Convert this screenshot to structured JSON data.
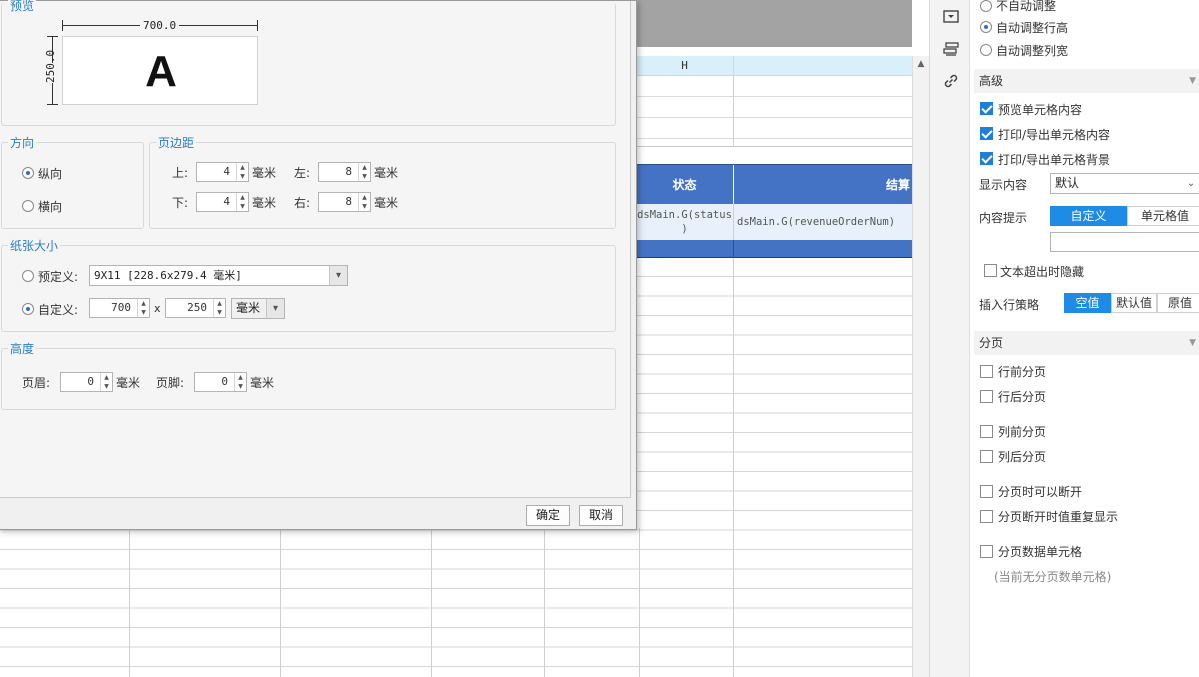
{
  "dialog": {
    "preview": {
      "title": "预览",
      "width_label": "700.0",
      "height_label": "250.0",
      "letter": "A"
    },
    "orientation": {
      "title": "方向",
      "portrait": "纵向",
      "landscape": "横向",
      "selected": "portrait"
    },
    "margins": {
      "title": "页边距",
      "top_label": "上:",
      "top_value": "4",
      "left_label": "左:",
      "left_value": "8",
      "bottom_label": "下:",
      "bottom_value": "4",
      "right_label": "右:",
      "right_value": "8",
      "unit": "毫米"
    },
    "paper": {
      "title": "纸张大小",
      "predefined_label": "预定义:",
      "predefined_value": "9X11 [228.6x279.4 毫米]",
      "custom_label": "自定义:",
      "custom_width": "700",
      "custom_x": "x",
      "custom_height": "250",
      "custom_unit": "毫米",
      "selected": "custom"
    },
    "height": {
      "title": "高度",
      "header_label": "页眉:",
      "header_value": "0",
      "footer_label": "页脚:",
      "footer_value": "0",
      "unit": "毫米"
    },
    "buttons": {
      "ok": "确定",
      "cancel": "取消"
    }
  },
  "sheet": {
    "col_H": "H",
    "header_status": "状态",
    "header_result": "结算",
    "cell_status": "dsMain.G(status)",
    "cell_status_line1": "dsMain.G(status",
    "cell_status_line2": ")",
    "cell_revenue": "dsMain.G(revenueOrderNum)"
  },
  "right_panel": {
    "auto_adjust": {
      "none": "不自动调整",
      "row_height": "自动调整行高",
      "col_width": "自动调整列宽",
      "selected": "row_height"
    },
    "advanced": {
      "title": "高级",
      "preview_content": "预览单元格内容",
      "print_content": "打印/导出单元格内容",
      "print_background": "打印/导出单元格背景",
      "display_label": "显示内容",
      "display_value": "默认",
      "tooltip_label": "内容提示",
      "tooltip_custom": "自定义",
      "tooltip_cell": "单元格值",
      "hide_overflow": "文本超出时隐藏",
      "insert_label": "插入行策略",
      "insert_empty": "空值",
      "insert_default": "默认值",
      "insert_original": "原值"
    },
    "pagination": {
      "title": "分页",
      "before_row": "行前分页",
      "after_row": "行后分页",
      "before_col": "列前分页",
      "after_col": "列后分页",
      "can_break": "分页时可以断开",
      "repeat_on_break": "分页断开时值重复显示",
      "page_data_cell": "分页数据单元格",
      "no_cell_hint": "(当前无分页数单元格)"
    }
  },
  "colors": {
    "accent_blue": "#1e8be4",
    "table_header_blue": "#4472c4",
    "group_title_blue": "#2a7cc7"
  }
}
